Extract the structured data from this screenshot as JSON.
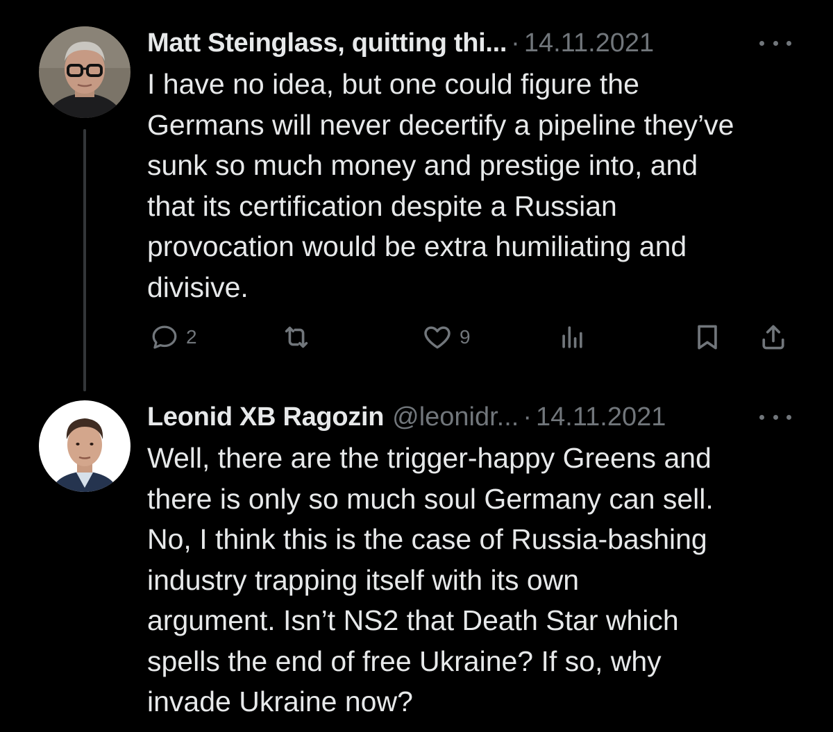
{
  "tweets": [
    {
      "name": "Matt Steinglass, quitting thi...",
      "handle": "",
      "separator": "·",
      "date": "14.11.2021",
      "text_lines": [
        "I have no idea, but one could figure the",
        "Germans will never decertify a pipeline they’ve",
        "sunk so much money and prestige into, and",
        "that its certification despite a Russian",
        "provocation would be extra humiliating and",
        "divisive."
      ],
      "actions": {
        "reply_icon": "reply-icon",
        "reply_count": "2",
        "retweet_icon": "retweet-icon",
        "like_icon": "heart-icon",
        "like_count": "9",
        "views_icon": "views-icon",
        "bookmark_icon": "bookmark-icon",
        "share_icon": "share-icon"
      }
    },
    {
      "name": "Leonid XB Ragozin",
      "handle": "@leonidr...",
      "separator": "·",
      "date": "14.11.2021",
      "text_lines": [
        "Well, there are the trigger-happy Greens and",
        "there is only so much soul Germany can sell.",
        "No, I think this is the case of Russia-bashing",
        "industry trapping itself with its own",
        "argument. Isn’t NS2 that Death Star which",
        "spells the end of free Ukraine? If so, why",
        "invade Ukraine now?"
      ]
    }
  ],
  "colors": {
    "background": "#000000",
    "text_primary": "#e7e9ea",
    "text_secondary": "#71767b",
    "thread_line": "#333639"
  }
}
